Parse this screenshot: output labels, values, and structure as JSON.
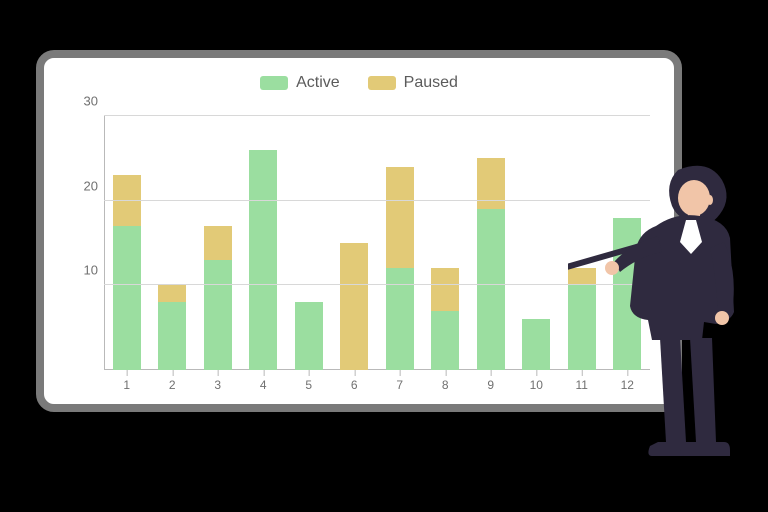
{
  "legend": {
    "active": "Active",
    "paused": "Paused"
  },
  "colors": {
    "active": "#9bdea0",
    "paused": "#e2ca77",
    "frame": "#7a7a7a"
  },
  "chart_data": {
    "type": "bar",
    "stacked": true,
    "categories": [
      "1",
      "2",
      "3",
      "4",
      "5",
      "6",
      "7",
      "8",
      "9",
      "10",
      "11",
      "12"
    ],
    "series": [
      {
        "name": "Active",
        "values": [
          17,
          8,
          13,
          26,
          8,
          0,
          12,
          7,
          19,
          6,
          10,
          18
        ]
      },
      {
        "name": "Paused",
        "values": [
          6,
          2,
          4,
          0,
          0,
          15,
          12,
          5,
          6,
          0,
          2,
          0
        ]
      }
    ],
    "ylabel": "",
    "xlabel": "",
    "ylim": [
      0,
      30
    ],
    "yticks": [
      10,
      20,
      30
    ],
    "grid": true,
    "legend_position": "top"
  }
}
